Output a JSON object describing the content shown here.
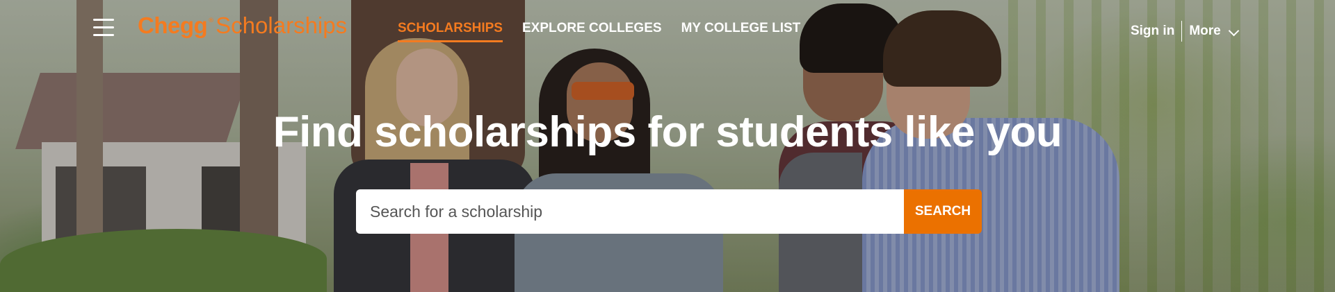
{
  "logo": {
    "brand": "Chegg",
    "registered": "®",
    "product": "Scholarships"
  },
  "nav": {
    "items": [
      {
        "label": "SCHOLARSHIPS",
        "active": true
      },
      {
        "label": "EXPLORE COLLEGES",
        "active": false
      },
      {
        "label": "MY COLLEGE LIST",
        "active": false
      }
    ]
  },
  "user_nav": {
    "sign_in": "Sign in",
    "more": "More"
  },
  "hero": {
    "headline": "Find scholarships for students like you"
  },
  "search": {
    "placeholder": "Search for a scholarship",
    "button_label": "SEARCH"
  },
  "icons": {
    "menu": "hamburger-menu-icon",
    "more": "chevron-down-icon"
  },
  "colors": {
    "brand_orange": "#f47b20",
    "search_button": "#eb7100",
    "text_light": "#ffffff"
  }
}
